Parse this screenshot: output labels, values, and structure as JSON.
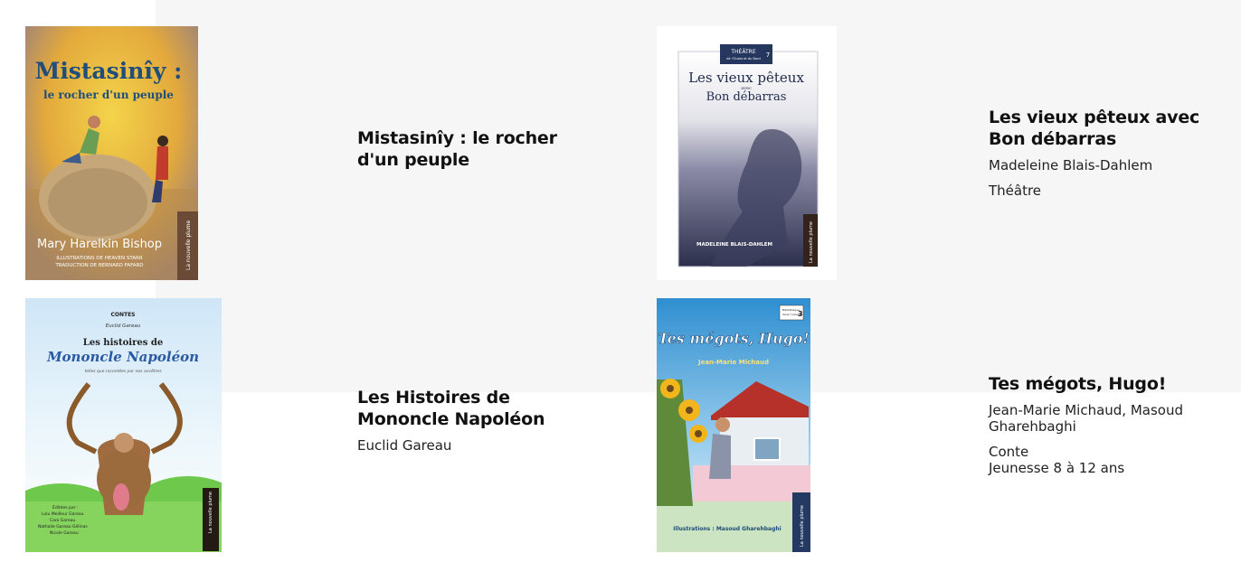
{
  "books": [
    {
      "title": "Mistasinîy : le rocher d'un peuple",
      "cover": {
        "title_line1": "Mistasinîy :",
        "title_line2": "le rocher d'un peuple",
        "author": "Mary Harelkin Bishop",
        "credit1": "ILLUSTRATIONS DE HEAVEN STARR",
        "credit2": "TRADUCTION DE BERNARD FAFARD",
        "publisher": "La nouvelle plume"
      }
    },
    {
      "title": "Les vieux pêteux avec Bon débarras",
      "author": "Madeleine Blais-Dahlem",
      "genre": "Théâtre",
      "cover": {
        "series_line1": "THÉÂTRE",
        "series_line2": "de l'Ouest et du Nord",
        "series_number": "7",
        "title_line1": "Les vieux pêteux",
        "title_connector": "avec",
        "title_line2": "Bon débarras",
        "author": "MADELEINE BLAIS-DAHLEM",
        "publisher": "La nouvelle plume"
      }
    },
    {
      "title": "Les Histoires de Mononcle Napoléon",
      "author": "Euclid Gareau",
      "cover": {
        "category": "CONTES",
        "author": "Euclid Gareau",
        "title_line1": "Les histoires de",
        "title_line2": "Mononcle Napoléon",
        "subtitle": "telles que racontées par nos ancêtres",
        "edited_by": "Éditées par :",
        "editors": [
          "Lulu Meilleur Gareau",
          "Caro Gareau",
          "Nathalie Gareau Gélinas",
          "Nicole Gareau"
        ],
        "publisher": "La nouvelle plume"
      }
    },
    {
      "title": "Tes mégots, Hugo!",
      "author": "Jean-Marie Michaud, Masoud Gharehbaghi",
      "genre": "Conte",
      "audience": "Jeunesse 8 à 12 ans",
      "cover": {
        "collection_line1": "Bibliothèque",
        "collection_line2": "dans l'univers",
        "collection_number": "3",
        "title": "Tes mégots, Hugo!",
        "author": "Jean-Marie Michaud",
        "illustrations": "Illustrations : Masoud Gharehbaghi",
        "publisher": "La nouvelle plume"
      }
    }
  ]
}
